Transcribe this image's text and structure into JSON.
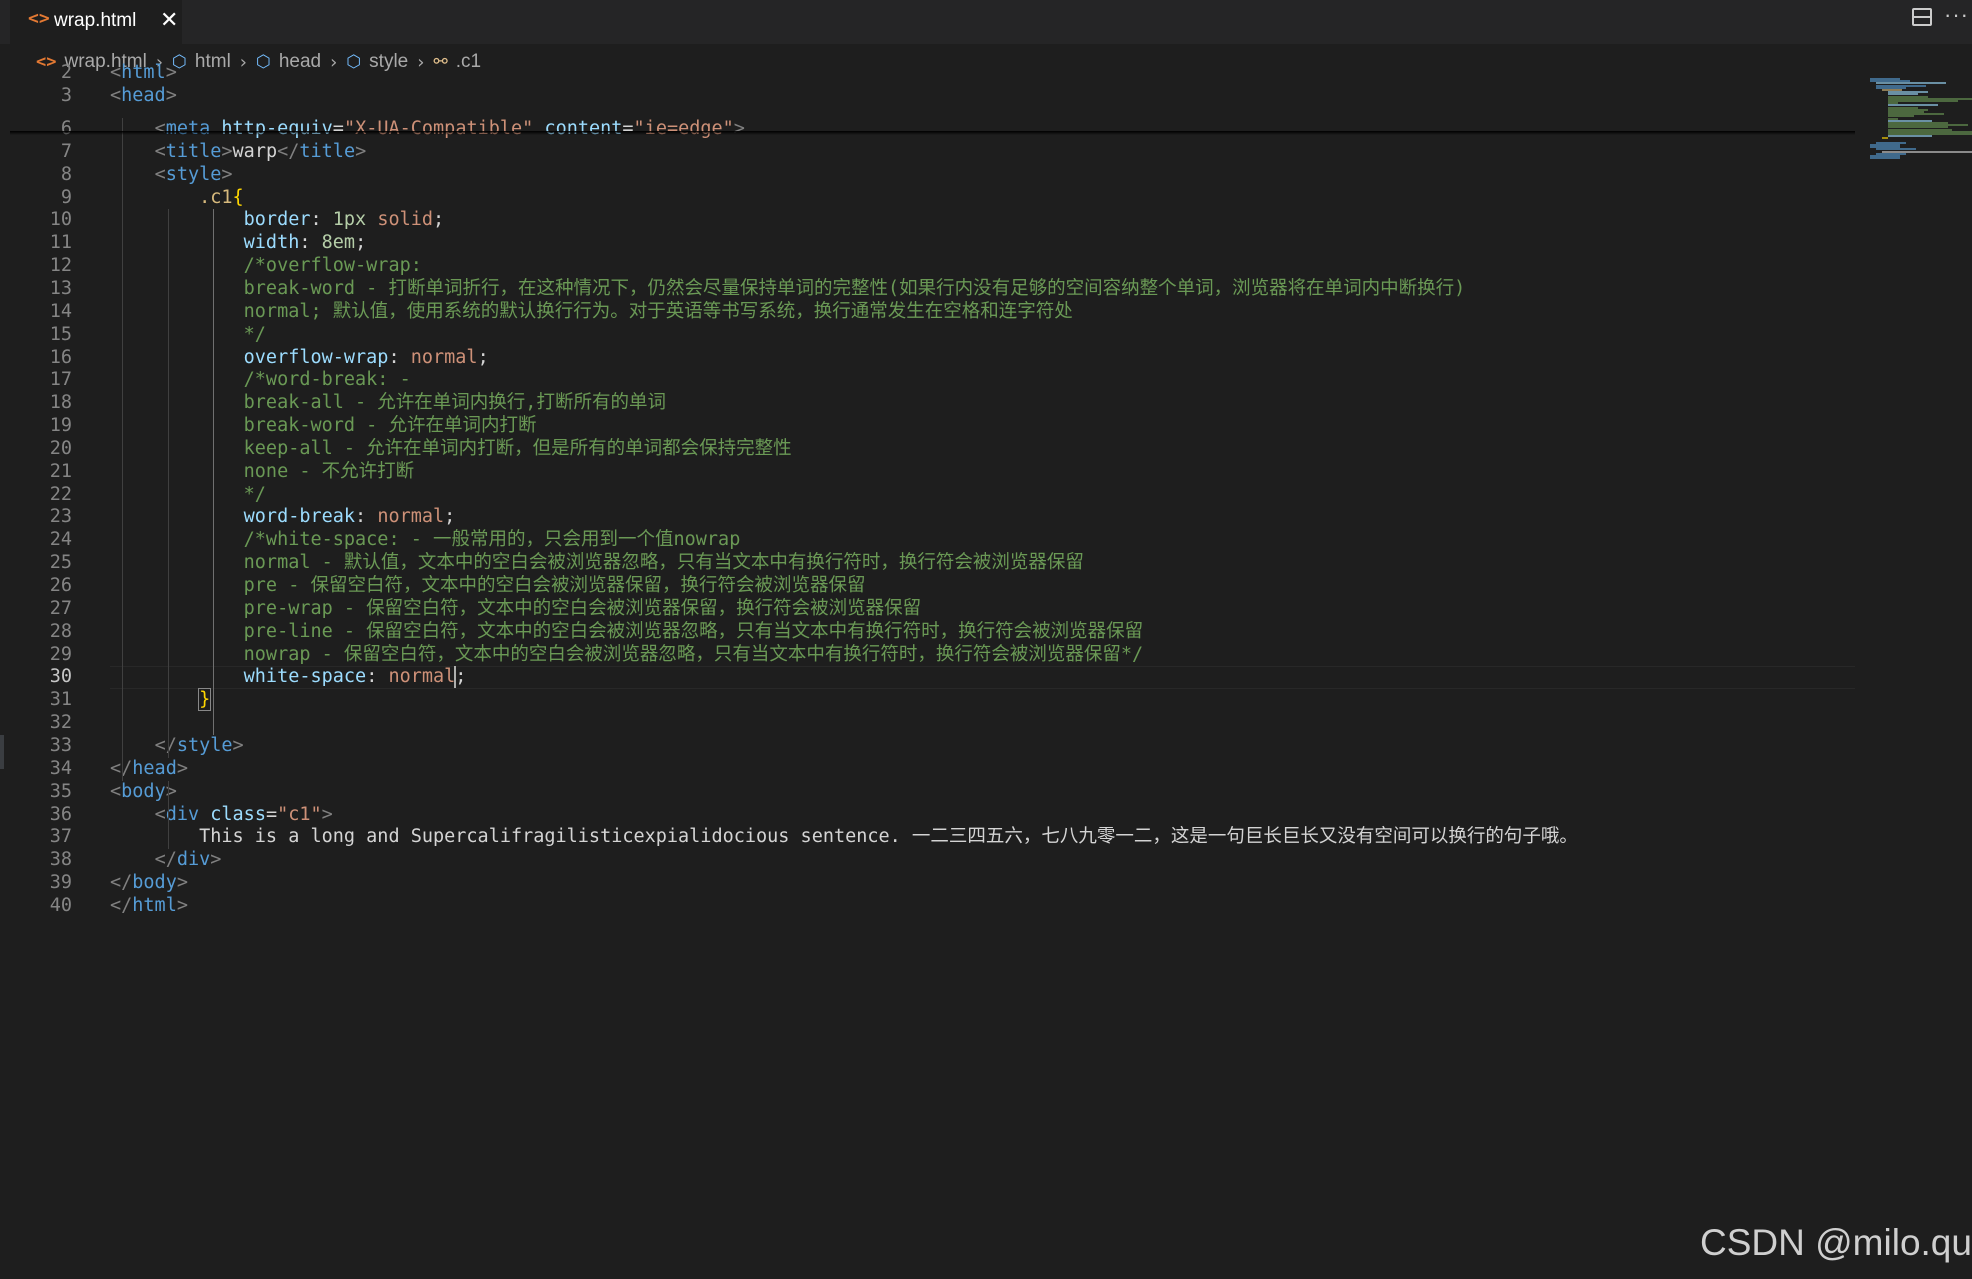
{
  "tab": {
    "icon": "html-file-icon",
    "icon_glyph": "<>",
    "label": "wrap.html",
    "close": "✕"
  },
  "editor_actions": {
    "split": "split-editor-icon",
    "more": "···"
  },
  "breadcrumb": [
    {
      "label": "wrap.html",
      "icon": "html-file-icon",
      "glyph": "<>"
    },
    {
      "label": "html",
      "icon": "element-cube-icon",
      "glyph": "⬡"
    },
    {
      "label": "head",
      "icon": "element-cube-icon",
      "glyph": "⬡"
    },
    {
      "label": "style",
      "icon": "element-cube-icon",
      "glyph": "⬡"
    },
    {
      "label": ".c1",
      "icon": "css-selector-icon",
      "glyph": "⚯"
    }
  ],
  "active_line": 30,
  "lines": [
    {
      "n": 2,
      "t": [
        [
          "c-punct",
          "<"
        ],
        [
          "c-tag",
          "html"
        ],
        [
          "c-punct",
          ">"
        ]
      ]
    },
    {
      "n": 3,
      "t": [
        [
          "c-punct",
          "<"
        ],
        [
          "c-tag",
          "head"
        ],
        [
          "c-punct",
          ">"
        ]
      ]
    },
    {
      "n": 6,
      "t": [
        [
          "c-text",
          "    "
        ],
        [
          "c-punct",
          "<"
        ],
        [
          "c-tag",
          "meta"
        ],
        [
          "c-text",
          " "
        ],
        [
          "c-attr",
          "http-equiv"
        ],
        [
          "c-text",
          "="
        ],
        [
          "c-str",
          "\"X-UA-Compatible\""
        ],
        [
          "c-text",
          " "
        ],
        [
          "c-attr",
          "content"
        ],
        [
          "c-text",
          "="
        ],
        [
          "c-str",
          "\"ie=edge\""
        ],
        [
          "c-punct",
          ">"
        ]
      ]
    },
    {
      "n": 7,
      "t": [
        [
          "c-text",
          "    "
        ],
        [
          "c-punct",
          "<"
        ],
        [
          "c-tag",
          "title"
        ],
        [
          "c-punct",
          ">"
        ],
        [
          "c-text",
          "warp"
        ],
        [
          "c-punct",
          "</"
        ],
        [
          "c-tag",
          "title"
        ],
        [
          "c-punct",
          ">"
        ]
      ]
    },
    {
      "n": 8,
      "t": [
        [
          "c-text",
          "    "
        ],
        [
          "c-punct",
          "<"
        ],
        [
          "c-tag",
          "style"
        ],
        [
          "c-punct",
          ">"
        ]
      ]
    },
    {
      "n": 9,
      "t": [
        [
          "c-text",
          "        "
        ],
        [
          "c-sel",
          ".c1"
        ],
        [
          "c-brace",
          "{"
        ]
      ]
    },
    {
      "n": 10,
      "t": [
        [
          "c-text",
          "            "
        ],
        [
          "c-prop",
          "border"
        ],
        [
          "c-text",
          ": "
        ],
        [
          "c-num",
          "1px"
        ],
        [
          "c-text",
          " "
        ],
        [
          "c-val",
          "solid"
        ],
        [
          "c-text",
          ";"
        ]
      ]
    },
    {
      "n": 11,
      "t": [
        [
          "c-text",
          "            "
        ],
        [
          "c-prop",
          "width"
        ],
        [
          "c-text",
          ": "
        ],
        [
          "c-num",
          "8em"
        ],
        [
          "c-text",
          ";"
        ]
      ]
    },
    {
      "n": 12,
      "t": [
        [
          "c-text",
          "            "
        ],
        [
          "c-cmt",
          "/*overflow-wrap:"
        ]
      ]
    },
    {
      "n": 13,
      "t": [
        [
          "c-text",
          "            "
        ],
        [
          "c-cmt",
          "break-word - 打断单词折行，在这种情况下，仍然会尽量保持单词的完整性(如果行内没有足够的空间容纳整个单词，浏览器将在单词内中断换行)"
        ]
      ]
    },
    {
      "n": 14,
      "t": [
        [
          "c-text",
          "            "
        ],
        [
          "c-cmt",
          "normal; 默认值，使用系统的默认换行行为。对于英语等书写系统，换行通常发生在空格和连字符处"
        ]
      ]
    },
    {
      "n": 15,
      "t": [
        [
          "c-text",
          "            "
        ],
        [
          "c-cmt",
          "*/"
        ]
      ]
    },
    {
      "n": 16,
      "t": [
        [
          "c-text",
          "            "
        ],
        [
          "c-prop",
          "overflow-wrap"
        ],
        [
          "c-text",
          ": "
        ],
        [
          "c-val",
          "normal"
        ],
        [
          "c-text",
          ";"
        ]
      ]
    },
    {
      "n": 17,
      "t": [
        [
          "c-text",
          "            "
        ],
        [
          "c-cmt",
          "/*word-break: -"
        ]
      ]
    },
    {
      "n": 18,
      "t": [
        [
          "c-text",
          "            "
        ],
        [
          "c-cmt",
          "break-all - 允许在单词内换行,打断所有的单词"
        ]
      ]
    },
    {
      "n": 19,
      "t": [
        [
          "c-text",
          "            "
        ],
        [
          "c-cmt",
          "break-word - 允许在单词内打断"
        ]
      ]
    },
    {
      "n": 20,
      "t": [
        [
          "c-text",
          "            "
        ],
        [
          "c-cmt",
          "keep-all - 允许在单词内打断，但是所有的单词都会保持完整性"
        ]
      ]
    },
    {
      "n": 21,
      "t": [
        [
          "c-text",
          "            "
        ],
        [
          "c-cmt",
          "none - 不允许打断"
        ]
      ]
    },
    {
      "n": 22,
      "t": [
        [
          "c-text",
          "            "
        ],
        [
          "c-cmt",
          "*/"
        ]
      ]
    },
    {
      "n": 23,
      "t": [
        [
          "c-text",
          "            "
        ],
        [
          "c-prop",
          "word-break"
        ],
        [
          "c-text",
          ": "
        ],
        [
          "c-val",
          "normal"
        ],
        [
          "c-text",
          ";"
        ]
      ]
    },
    {
      "n": 24,
      "t": [
        [
          "c-text",
          "            "
        ],
        [
          "c-cmt",
          "/*white-space: - 一般常用的，只会用到一个值nowrap"
        ]
      ]
    },
    {
      "n": 25,
      "t": [
        [
          "c-text",
          "            "
        ],
        [
          "c-cmt",
          "normal - 默认值，文本中的空白会被浏览器忽略，只有当文本中有换行符时，换行符会被浏览器保留"
        ]
      ]
    },
    {
      "n": 26,
      "t": [
        [
          "c-text",
          "            "
        ],
        [
          "c-cmt",
          "pre - 保留空白符，文本中的空白会被浏览器保留，换行符会被浏览器保留"
        ]
      ]
    },
    {
      "n": 27,
      "t": [
        [
          "c-text",
          "            "
        ],
        [
          "c-cmt",
          "pre-wrap - 保留空白符，文本中的空白会被浏览器保留，换行符会被浏览器保留"
        ]
      ]
    },
    {
      "n": 28,
      "t": [
        [
          "c-text",
          "            "
        ],
        [
          "c-cmt",
          "pre-line - 保留空白符，文本中的空白会被浏览器忽略，只有当文本中有换行符时，换行符会被浏览器保留"
        ]
      ]
    },
    {
      "n": 29,
      "t": [
        [
          "c-text",
          "            "
        ],
        [
          "c-cmt",
          "nowrap - 保留空白符，文本中的空白会被浏览器忽略，只有当文本中有换行符时，换行符会被浏览器保留*/"
        ]
      ]
    },
    {
      "n": 30,
      "t": [
        [
          "c-text",
          "            "
        ],
        [
          "c-prop",
          "white-space"
        ],
        [
          "c-text",
          ": "
        ],
        [
          "c-val",
          "normal"
        ],
        [
          "cursor",
          ""
        ],
        [
          "c-text",
          ";"
        ]
      ]
    },
    {
      "n": 31,
      "t": [
        [
          "c-text",
          "        "
        ],
        [
          "c-brace-box",
          "}"
        ]
      ]
    },
    {
      "n": 32,
      "t": []
    },
    {
      "n": 33,
      "t": [
        [
          "c-text",
          "    "
        ],
        [
          "c-punct",
          "</"
        ],
        [
          "c-tag",
          "style"
        ],
        [
          "c-punct",
          ">"
        ]
      ]
    },
    {
      "n": 34,
      "t": [
        [
          "c-punct",
          "</"
        ],
        [
          "c-tag",
          "head"
        ],
        [
          "c-punct",
          ">"
        ]
      ]
    },
    {
      "n": 35,
      "t": [
        [
          "c-punct",
          "<"
        ],
        [
          "c-tag",
          "body"
        ],
        [
          "c-punct",
          ">"
        ]
      ]
    },
    {
      "n": 36,
      "t": [
        [
          "c-text",
          "    "
        ],
        [
          "c-punct",
          "<"
        ],
        [
          "c-tag",
          "div"
        ],
        [
          "c-text",
          " "
        ],
        [
          "c-attr",
          "class"
        ],
        [
          "c-text",
          "="
        ],
        [
          "c-str",
          "\"c1\""
        ],
        [
          "c-punct",
          ">"
        ]
      ]
    },
    {
      "n": 37,
      "t": [
        [
          "c-text",
          "        This is a long and Supercalifragilisticexpialidocious sentence. 一二三四五六，七八九零一二，这是一句巨长巨长又没有空间可以换行的句子哦。"
        ]
      ]
    },
    {
      "n": 38,
      "t": [
        [
          "c-text",
          "    "
        ],
        [
          "c-punct",
          "</"
        ],
        [
          "c-tag",
          "div"
        ],
        [
          "c-punct",
          ">"
        ]
      ]
    },
    {
      "n": 39,
      "t": [
        [
          "c-punct",
          "</"
        ],
        [
          "c-tag",
          "body"
        ],
        [
          "c-punct",
          ">"
        ]
      ]
    },
    {
      "n": 40,
      "t": [
        [
          "c-punct",
          "</"
        ],
        [
          "c-tag",
          "html"
        ],
        [
          "c-punct",
          ">"
        ]
      ]
    }
  ],
  "watermark": "CSDN @milo.qu",
  "colors": {
    "background": "#1e1e1e",
    "tag": "#569cd6",
    "attribute": "#9cdcfe",
    "string": "#ce9178",
    "comment": "#6a9955",
    "selector": "#d7ba7d",
    "bracket": "#ffd700"
  }
}
